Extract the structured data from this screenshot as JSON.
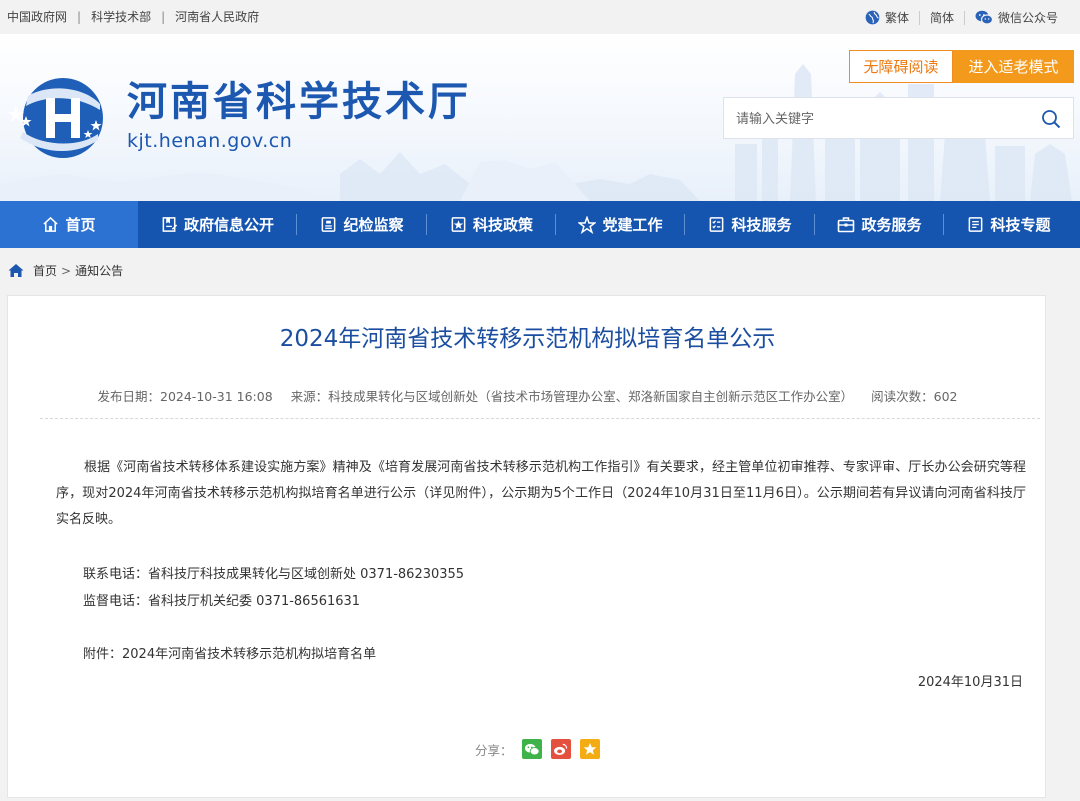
{
  "topbar": {
    "links": [
      "中国政府网",
      "科学技术部",
      "河南省人民政府"
    ],
    "separator": "|",
    "traditional": "繁体",
    "simplified": "简体",
    "wechat": "微信公众号"
  },
  "header": {
    "title": "河南省科学技术厅",
    "domain": "kjt.henan.gov.cn",
    "accessible_label": "无障碍阅读",
    "elder_label": "进入适老模式",
    "search_placeholder": "请输入关键字",
    "icons": {
      "logo": "henan-kjt-logo",
      "search": "search-icon"
    }
  },
  "nav": {
    "items": [
      {
        "label": "首页",
        "icon": "home-icon"
      },
      {
        "label": "政府信息公开",
        "icon": "info-open-icon"
      },
      {
        "label": "纪检监察",
        "icon": "inspection-icon"
      },
      {
        "label": "科技政策",
        "icon": "policy-icon"
      },
      {
        "label": "党建工作",
        "icon": "star-icon"
      },
      {
        "label": "科技服务",
        "icon": "service-icon"
      },
      {
        "label": "政务服务",
        "icon": "briefcase-icon"
      },
      {
        "label": "科技专题",
        "icon": "topic-icon"
      }
    ]
  },
  "breadcrumb": {
    "home": "首页",
    "sep": ">",
    "current": "通知公告"
  },
  "article": {
    "title": "2024年河南省技术转移示范机构拟培育名单公示",
    "meta": {
      "date": "发布日期：2024-10-31 16:08",
      "source": "来源：科技成果转化与区域创新处（省技术市场管理办公室、郑洛新国家自主创新示范区工作办公室）",
      "views": "阅读次数：602"
    },
    "body": "根据《河南省技术转移体系建设实施方案》精神及《培育发展河南省技术转移示范机构工作指引》有关要求，经主管单位初审推荐、专家评审、厅长办公会研究等程序，现对2024年河南省技术转移示范机构拟培育名单进行公示（详见附件），公示期为5个工作日（2024年10月31日至11月6日）。公示期间若有异议请向河南省科技厅实名反映。",
    "contact": "联系电话：省科技厅科技成果转化与区域创新处 0371-86230355",
    "supervision": "监督电话：省科技厅机关纪委 0371-86561631",
    "attachment": "附件：2024年河南省技术转移示范机构拟培育名单",
    "date_sign": "2024年10月31日",
    "share_label": "分享：",
    "share_icons": [
      "wechat-icon",
      "weibo-icon",
      "favorite-icon"
    ]
  },
  "colors": {
    "primary": "#1555b0",
    "nav_active": "#2c72d2",
    "title": "#1b4ea0",
    "orange": "#f39a1d",
    "wechat": "#3db34a",
    "weibo": "#e5513f",
    "favorite": "#f3ac14"
  }
}
